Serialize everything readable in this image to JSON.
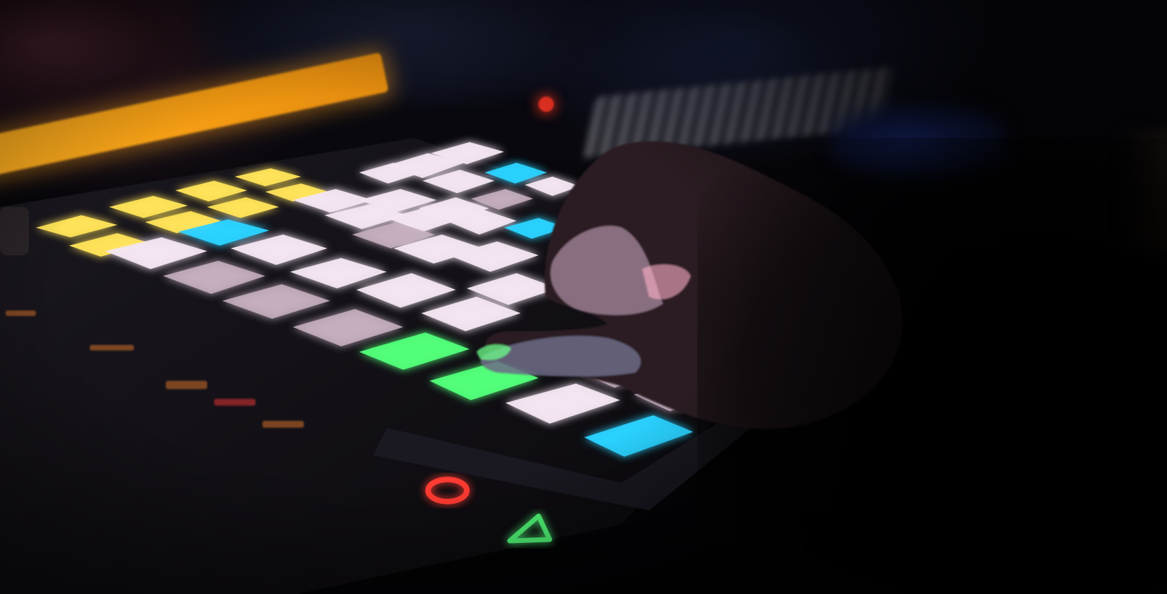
{
  "photo": {
    "subject": "controller-pad-grid",
    "colors": {
      "white": "#f3e6f2",
      "pink": "#c9b3c3",
      "yellow": "#ffe45a",
      "blue": "#2bd3ff",
      "green": "#52ff7a",
      "orange": "#ffaa1e",
      "red": "#ff3a30"
    }
  }
}
